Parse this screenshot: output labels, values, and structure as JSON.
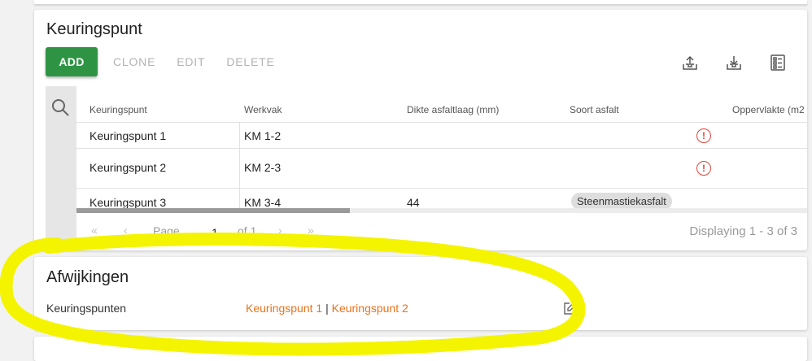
{
  "card1": {
    "title": "Keuringspunt",
    "toolbar": {
      "add": "ADD",
      "clone": "CLONE",
      "edit": "EDIT",
      "delete": "DELETE"
    },
    "icons": [
      "upload-icon",
      "download-icon",
      "column-list-icon"
    ],
    "columns": [
      "Keuringspunt",
      "Werkvak",
      "Dikte asfaltlaag (mm)",
      "Soort asfalt",
      "Oppervlakte (m2"
    ],
    "rows": [
      {
        "keuringspunt": "Keuringspunt 1",
        "werkvak": "KM 1-2",
        "dikte": "",
        "soort": "",
        "alert": true
      },
      {
        "keuringspunt": "Keuringspunt 2",
        "werkvak": "KM 2-3",
        "dikte": "",
        "soort": "",
        "alert": true
      },
      {
        "keuringspunt": "Keuringspunt 3",
        "werkvak": "KM 3-4",
        "dikte": "44",
        "soort": "Steenmastiekasfalt",
        "alert": false
      }
    ],
    "pager": {
      "page_label": "Page",
      "page_value": "1",
      "of_label": "of 1",
      "displaying": "Displaying 1 - 3 of 3"
    }
  },
  "card2": {
    "title": "Afwijkingen",
    "label": "Keuringspunten",
    "link1": "Keuringspunt 1",
    "separator": " | ",
    "link2": "Keuringspunt 2"
  },
  "colors": {
    "add_button": "#2e9444",
    "link": "#e8731c",
    "alert": "#e0443a",
    "highlight": "#f4f400"
  }
}
